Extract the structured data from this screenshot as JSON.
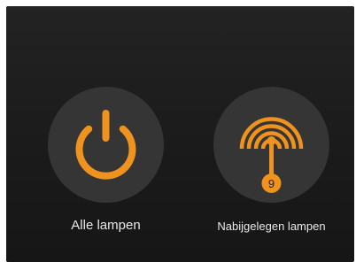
{
  "accent_color": "#f0931e",
  "actions": {
    "all_lamps": {
      "label": "Alle lampen",
      "icon": "power-icon"
    },
    "nearby_lamps": {
      "label": "Nabijgelegen lampen",
      "icon": "beacon-signal-icon",
      "count": "9"
    }
  }
}
